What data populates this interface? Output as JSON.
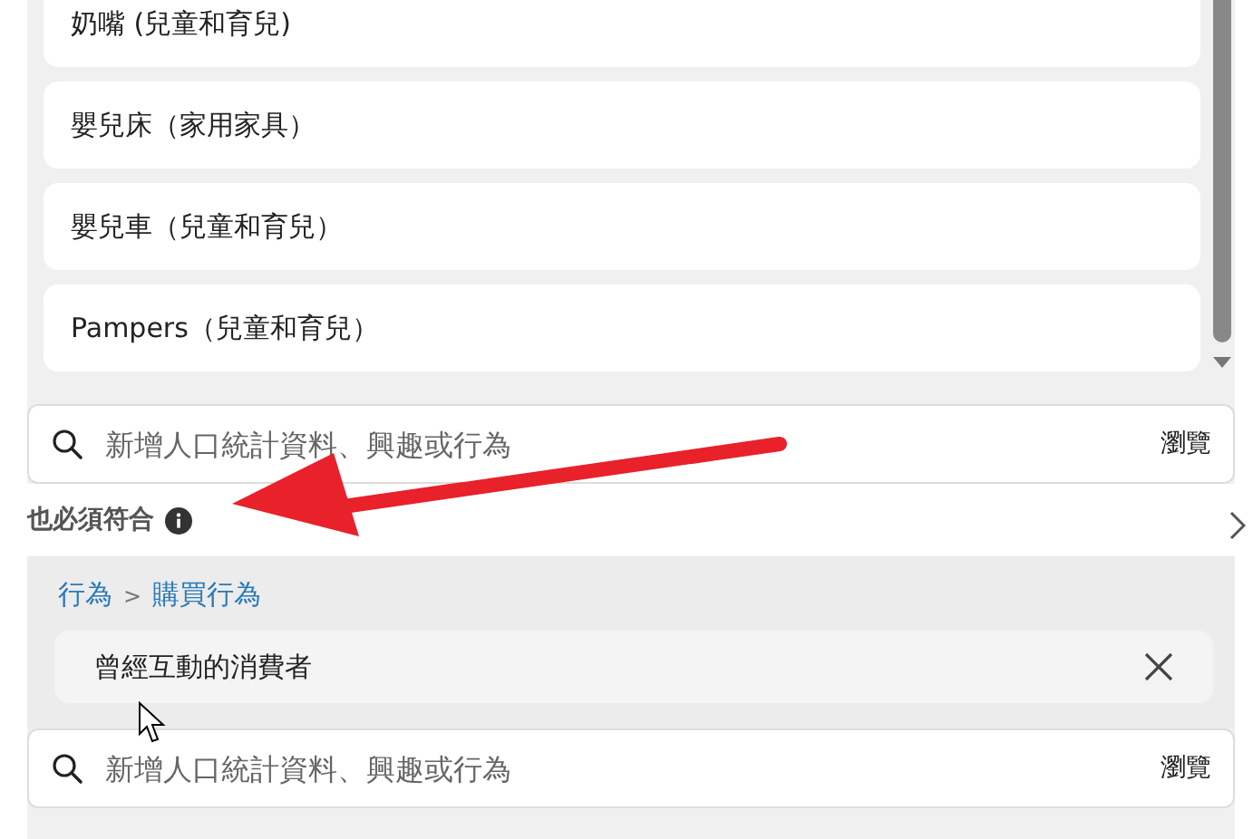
{
  "suggestions": [
    {
      "label": "奶嘴 (兒童和育兒)"
    },
    {
      "label": "嬰兒床（家用家具）"
    },
    {
      "label": "嬰兒車（兒童和育兒）"
    },
    {
      "label": "Pampers（兒童和育兒）"
    }
  ],
  "search_top": {
    "placeholder": "新增人口統計資料、興趣或行為",
    "browse": "瀏覽"
  },
  "also_match": {
    "title": "也必須符合"
  },
  "criteria": {
    "breadcrumb": [
      {
        "label": "行為"
      },
      {
        "label": "購買行為"
      }
    ],
    "separator": ">",
    "items": [
      {
        "label": "曾經互動的消費者"
      }
    ]
  },
  "search_bottom": {
    "placeholder": "新增人口統計資料、興趣或行為",
    "browse": "瀏覽"
  }
}
